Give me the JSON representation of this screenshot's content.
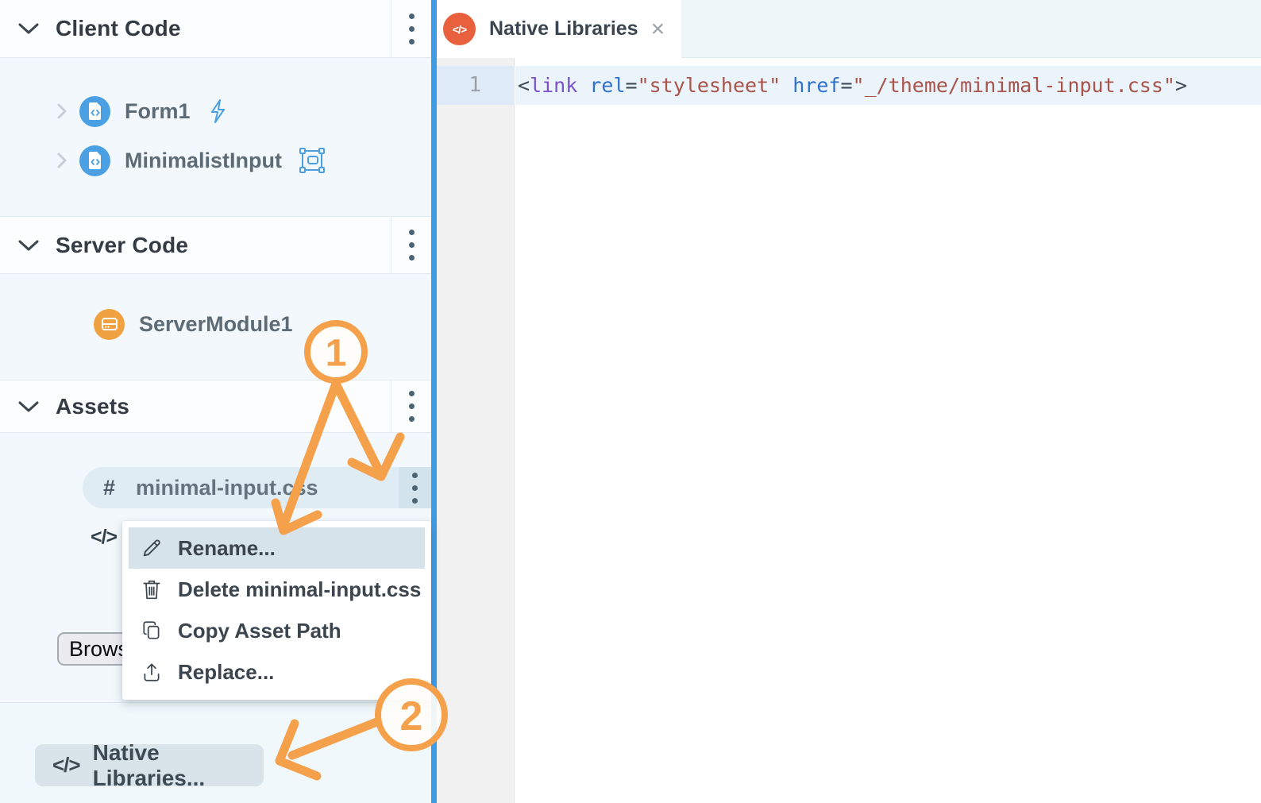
{
  "sidebar": {
    "client_section": {
      "title": "Client Code",
      "items": [
        {
          "label": "Form1"
        },
        {
          "label": "MinimalistInput"
        }
      ]
    },
    "server_section": {
      "title": "Server Code",
      "items": [
        {
          "label": "ServerModule1"
        }
      ]
    },
    "assets_section": {
      "title": "Assets",
      "asset": {
        "hash_glyph": "#",
        "label": "minimal-input.css"
      },
      "hidden_asset_glyph": "</>"
    },
    "browse_button_label": "Browse...",
    "native_libraries_button": {
      "icon_glyph": "</>",
      "label": "Native Libraries..."
    }
  },
  "context_menu": {
    "items": [
      {
        "label": "Rename...",
        "icon": "pencil-icon",
        "highlighted": true
      },
      {
        "label": "Delete minimal-input.css",
        "icon": "trash-icon",
        "highlighted": false
      },
      {
        "label": "Copy Asset Path",
        "icon": "copy-icon",
        "highlighted": false
      },
      {
        "label": "Replace...",
        "icon": "upload-icon",
        "highlighted": false
      }
    ]
  },
  "editor": {
    "tab": {
      "title": "Native Libraries",
      "icon_glyph": "</>",
      "close_glyph": "×"
    },
    "line_number": "1",
    "code_tokens": [
      {
        "text": "<",
        "type": "punct"
      },
      {
        "text": "link",
        "type": "tag"
      },
      {
        "text": " ",
        "type": "plain"
      },
      {
        "text": "rel",
        "type": "attr"
      },
      {
        "text": "=",
        "type": "punct"
      },
      {
        "text": "\"stylesheet\"",
        "type": "string"
      },
      {
        "text": " ",
        "type": "plain"
      },
      {
        "text": "href",
        "type": "attr"
      },
      {
        "text": "=",
        "type": "punct"
      },
      {
        "text": "\"_/theme/minimal-input.css\"",
        "type": "string"
      },
      {
        "text": ">",
        "type": "punct"
      }
    ]
  },
  "annotations": {
    "step1": "1",
    "step2": "2",
    "accent_color": "#F5A04B"
  },
  "colors": {
    "divider_blue": "#3D9CE8",
    "file_icon_blue": "#4B9FE3",
    "server_icon_orange": "#F0A240",
    "tab_icon_orange": "#E8603D",
    "annotation_orange": "#F5A04B",
    "menu_highlight": "#D6E3EA",
    "asset_pill": "#DFECF3"
  }
}
